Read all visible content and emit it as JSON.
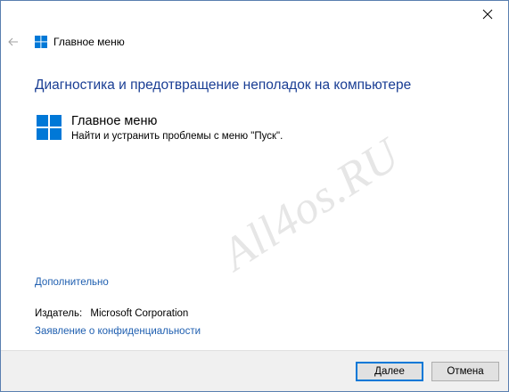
{
  "header": {
    "title": "Главное меню"
  },
  "page": {
    "heading": "Диагностика и предотвращение неполадок на компьютере"
  },
  "item": {
    "title": "Главное меню",
    "description": "Найти и устранить проблемы с меню \"Пуск\"."
  },
  "watermark": "All4os.RU",
  "links": {
    "advanced": "Дополнительно",
    "privacy": "Заявление о конфиденциальности"
  },
  "publisher": {
    "label": "Издатель:",
    "value": "Microsoft Corporation"
  },
  "buttons": {
    "next": "Далее",
    "cancel": "Отмена"
  },
  "icons": {
    "close": "close-icon",
    "back": "back-arrow-icon",
    "windows": "windows-logo-icon"
  },
  "colors": {
    "accent": "#1a3e94",
    "link": "#1f5fb0",
    "windows_blue": "#0078d7",
    "footer_bg": "#f0f0f0"
  }
}
